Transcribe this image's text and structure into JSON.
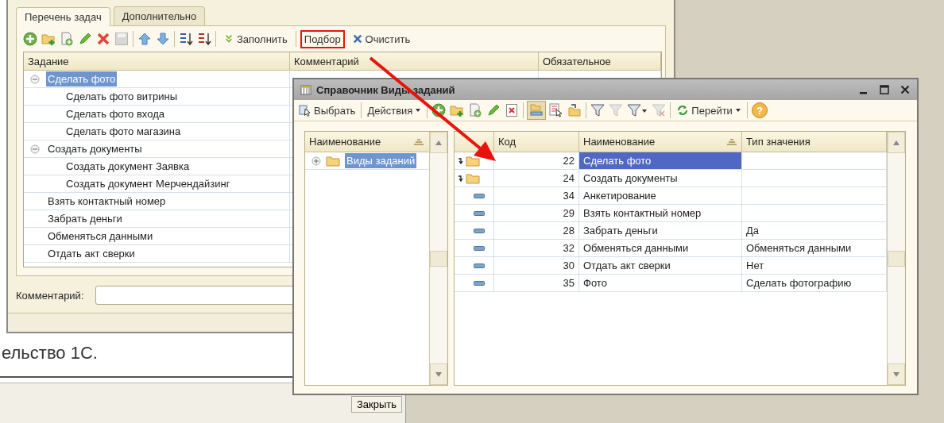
{
  "background_window": {
    "text": "ельство 1С.",
    "close_button": "Закрыть"
  },
  "main_window": {
    "tabs": [
      {
        "label": "Перечень задач",
        "selected": true
      },
      {
        "label": "Дополнительно",
        "selected": false
      }
    ],
    "toolbar": {
      "buttons": [
        {
          "label": "Заполнить",
          "highlighted": false
        },
        {
          "label": "Подбор",
          "highlighted": true
        },
        {
          "label": "Очистить",
          "highlighted": false
        }
      ]
    },
    "table": {
      "columns": [
        "Задание",
        "Комментарий",
        "Обязательное"
      ],
      "rows": [
        {
          "task": "Сделать фото",
          "selected": true,
          "expanded": true,
          "children": [
            {
              "task": "Сделать фото витрины",
              "selected": false
            },
            {
              "task": "Сделать фото входа",
              "selected": false
            },
            {
              "task": "Сделать фото магазина",
              "selected": false
            }
          ]
        },
        {
          "task": "Создать документы",
          "selected": false,
          "expanded": true,
          "children": [
            {
              "task": "Создать документ Заявка",
              "selected": false
            },
            {
              "task": "Создать документ Мерчендайзинг",
              "selected": false
            }
          ]
        },
        {
          "task": "Взять контактный номер",
          "selected": false
        },
        {
          "task": "Забрать деньги",
          "selected": false
        },
        {
          "task": "Обменяться данными",
          "selected": false
        },
        {
          "task": "Отдать акт сверки",
          "selected": false
        }
      ]
    },
    "comment": {
      "label": "Комментарий:"
    }
  },
  "dialog": {
    "title": "Справочник Виды заданий",
    "toolbar": {
      "select": "Выбрать",
      "actions": "Действия",
      "goto": "Перейти",
      "help": "?"
    },
    "tree": {
      "column": "Наименование",
      "items": [
        {
          "name": "Виды заданий",
          "selected": true,
          "expanded": false
        }
      ]
    },
    "list": {
      "columns": [
        "Код",
        "Наименование",
        "Тип значения"
      ],
      "rows": [
        {
          "kind": "folder",
          "code": "22",
          "name": "Сделать фото",
          "selected": true
        },
        {
          "kind": "folder",
          "code": "24",
          "name": "Создать документы",
          "selected": false
        },
        {
          "kind": "item",
          "code": "34",
          "name": "Анкетирование",
          "selected": false
        },
        {
          "kind": "item",
          "code": "29",
          "name": "Взять контактный номер",
          "selected": false
        },
        {
          "kind": "item",
          "code": "28",
          "name": "Забрать деньги",
          "value_type": "Да",
          "selected": false
        },
        {
          "kind": "item",
          "code": "32",
          "name": "Обменяться данными",
          "value_type": "Обменяться данными",
          "selected": false
        },
        {
          "kind": "item",
          "code": "30",
          "name": "Отдать акт сверки",
          "value_type": "Нет",
          "selected": false
        },
        {
          "kind": "item",
          "code": "35",
          "name": "Фото",
          "value_type": "Сделать фотографию",
          "selected": false
        }
      ]
    }
  }
}
